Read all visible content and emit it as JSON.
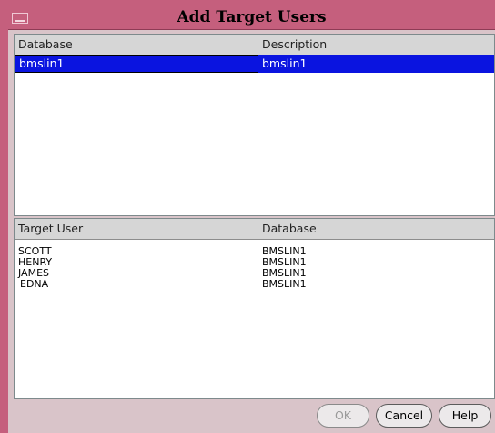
{
  "window": {
    "title": "Add Target Users"
  },
  "database_table": {
    "columns": [
      "Database",
      "Description"
    ],
    "rows": [
      {
        "database": "bmslin1",
        "description": "bmslin1"
      }
    ]
  },
  "target_users_table": {
    "columns": [
      "Target User",
      "Database"
    ],
    "rows": [
      {
        "user": "SCOTT",
        "database": "BMSLIN1"
      },
      {
        "user": "HENRY",
        "database": "BMSLIN1"
      },
      {
        "user": "JAMES",
        "database": "BMSLIN1"
      },
      {
        "user": "EDNA",
        "database": "BMSLIN1"
      }
    ]
  },
  "buttons": {
    "ok": "OK",
    "cancel": "Cancel",
    "help": "Help"
  },
  "colors": {
    "titlebar": "#c55f7d",
    "selection": "#0a14e0",
    "dialog_bg": "#d9c4c9"
  }
}
